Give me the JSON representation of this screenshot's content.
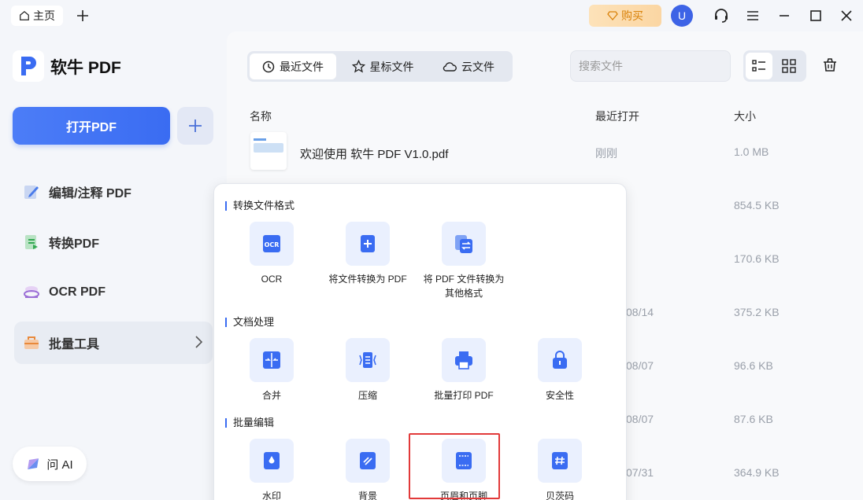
{
  "titlebar": {
    "home_tab": "主页",
    "buy_label": "购买",
    "avatar_initial": "U"
  },
  "sidebar": {
    "app_name": "软牛 PDF",
    "open_button": "打开PDF",
    "items": [
      {
        "label": "编辑/注释 PDF"
      },
      {
        "label": "转换PDF"
      },
      {
        "label": "OCR PDF"
      },
      {
        "label": "批量工具"
      }
    ],
    "ask_ai": "问 AI"
  },
  "main": {
    "tabs": [
      {
        "label": "最近文件"
      },
      {
        "label": "星标文件"
      },
      {
        "label": "云文件"
      }
    ],
    "search_placeholder": "搜索文件",
    "columns": {
      "name": "名称",
      "opened": "最近打开",
      "size": "大小"
    },
    "rows": [
      {
        "name": "欢迎使用 软牛 PDF V1.0.pdf",
        "opened": "刚刚",
        "size": "1.0 MB"
      },
      {
        "name": "",
        "opened": "",
        "size": "854.5 KB"
      },
      {
        "name": "",
        "opened": "",
        "size": "170.6 KB"
      },
      {
        "name": "",
        "opened": "08/14",
        "size": "375.2 KB"
      },
      {
        "name": "",
        "opened": "08/07",
        "size": "96.6 KB"
      },
      {
        "name": "",
        "opened": "08/07",
        "size": "87.6 KB"
      },
      {
        "name": "",
        "opened": "07/31",
        "size": "364.9 KB"
      }
    ]
  },
  "popup": {
    "sections": [
      {
        "title": "转换文件格式",
        "tools": [
          {
            "label": "OCR",
            "icon": "ocr-icon"
          },
          {
            "label": "将文件转换为 PDF",
            "icon": "file-plus-icon"
          },
          {
            "label": "将 PDF 文件转换为\n其他格式",
            "icon": "convert-icon"
          }
        ]
      },
      {
        "title": "文档处理",
        "tools": [
          {
            "label": "合并",
            "icon": "merge-icon"
          },
          {
            "label": "压缩",
            "icon": "compress-icon"
          },
          {
            "label": "批量打印 PDF",
            "icon": "print-icon"
          },
          {
            "label": "安全性",
            "icon": "lock-icon"
          }
        ]
      },
      {
        "title": "批量编辑",
        "tools": [
          {
            "label": "水印",
            "icon": "watermark-icon"
          },
          {
            "label": "背景",
            "icon": "background-icon"
          },
          {
            "label": "页眉和页脚",
            "icon": "header-footer-icon"
          },
          {
            "label": "贝茨码",
            "icon": "bates-icon"
          }
        ]
      }
    ]
  },
  "colors": {
    "accent": "#3a6cf2",
    "highlight_border": "#e23a3a",
    "buy_text": "#d9820a"
  }
}
